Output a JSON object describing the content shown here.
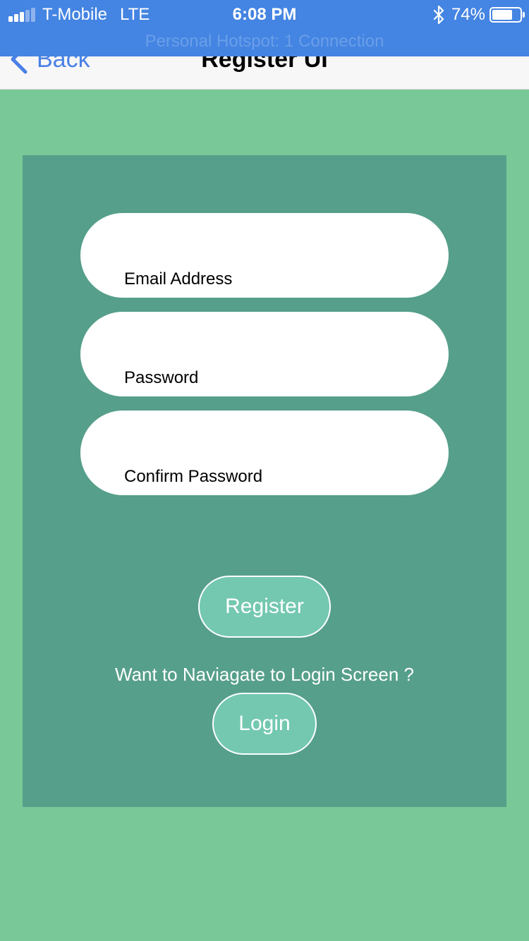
{
  "status_bar": {
    "carrier": "T-Mobile",
    "network": "LTE",
    "time": "6:08 PM",
    "battery_percent": "74%",
    "battery_level": 0.74,
    "signal_bars_filled": 3,
    "signal_bars_total": 5,
    "hotspot_banner": "Personal Hotspot: 1 Connection",
    "background_color": "#4484e2"
  },
  "nav": {
    "back_label": "Back",
    "title": "Register UI",
    "back_color": "#4a80e6"
  },
  "form": {
    "email_label": "Email Address",
    "password_label": "Password",
    "confirm_password_label": "Confirm Password",
    "register_label": "Register",
    "navigate_prompt": "Want to Naviagate to Login Screen ?",
    "login_label": "Login"
  },
  "colors": {
    "page_background": "#79c898",
    "card_background": "#569f8a",
    "button_background": "#74c8b0"
  }
}
